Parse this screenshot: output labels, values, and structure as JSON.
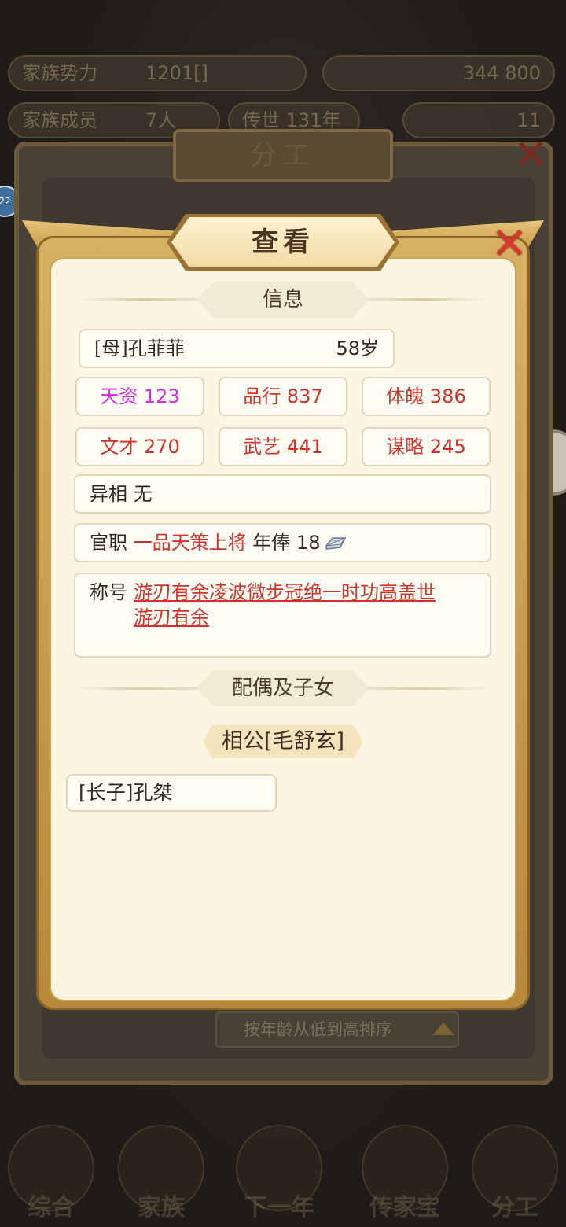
{
  "background": {
    "stats": [
      {
        "label": "家族势力",
        "value": "1201[",
        "extra": "]"
      },
      {
        "label": "家族成员",
        "value": "7人"
      },
      {
        "label": "传世",
        "value": "131年"
      }
    ],
    "currency": "344",
    "currency2": "800",
    "small_count": "11",
    "badge": "22",
    "back_title": "分工",
    "back_sort_label": "按年龄从低到高排序",
    "nav": [
      "综合",
      "家族",
      "下一年",
      "传家宝",
      "分工"
    ]
  },
  "modal": {
    "title": "查看",
    "info_section": "信息",
    "person": {
      "name": "[母]孔菲菲",
      "age": "58岁"
    },
    "stats": [
      {
        "label": "天资 123",
        "color": "#d42be0"
      },
      {
        "label": "品行 837",
        "color": "#d3322a"
      },
      {
        "label": "体魄 386",
        "color": "#d3322a"
      },
      {
        "label": "文才 270",
        "color": "#d3322a"
      },
      {
        "label": "武艺 441",
        "color": "#d3322a"
      },
      {
        "label": "谋略 245",
        "color": "#d3322a"
      }
    ],
    "trait": {
      "label": "异相",
      "value": "无"
    },
    "office": {
      "label": "官职",
      "value": "一品天策上将",
      "salary_label": "年俸",
      "salary": "18",
      "salary_icon": "silver-ingot-icon"
    },
    "titles": {
      "label": "称号",
      "line1": "游刃有余凌波微步冠绝一时功高盖世",
      "line2": "游刃有余"
    },
    "family_section": "配偶及子女",
    "spouse": "相公[毛舒玄]",
    "children": [
      "[长子]孔桀"
    ]
  }
}
